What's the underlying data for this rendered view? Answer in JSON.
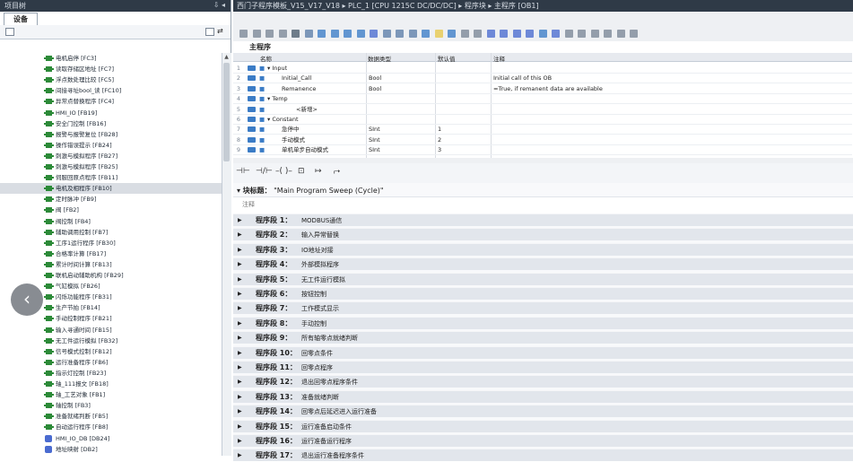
{
  "project_panel": {
    "title": "项目树",
    "pin_controls": "⇩ ◂",
    "devices_tab": "设备",
    "tree": [
      {
        "label": "电机启停 [FC3]",
        "kind": "block"
      },
      {
        "label": "读取存储区地址 [FC7]",
        "kind": "block"
      },
      {
        "label": "浮点数处理比较 [FC5]",
        "kind": "block"
      },
      {
        "label": "间接寻址bool_读 [FC10]",
        "kind": "block"
      },
      {
        "label": "异常点替换程序 [FC4]",
        "kind": "block"
      },
      {
        "label": "HMI_IO [FB19]",
        "kind": "block"
      },
      {
        "label": "安全门控制 [FB16]",
        "kind": "block"
      },
      {
        "label": "报警与报警复位 [FB28]",
        "kind": "block"
      },
      {
        "label": "操作错误提示 [FB24]",
        "kind": "block"
      },
      {
        "label": "刺激与模拟程序 [FB27]",
        "kind": "block"
      },
      {
        "label": "刺激与模拟程序 [FB25]",
        "kind": "block"
      },
      {
        "label": "伺服回原点程序 [FB11]",
        "kind": "block"
      },
      {
        "label": "电机及相程序 [FB10]",
        "kind": "block",
        "selected": true
      },
      {
        "label": "定时脉冲 [FB9]",
        "kind": "block"
      },
      {
        "label": "阀 [FB2]",
        "kind": "block"
      },
      {
        "label": "阀控制 [FB4]",
        "kind": "block"
      },
      {
        "label": "辅助调用控制 [FB7]",
        "kind": "block"
      },
      {
        "label": "工序1运行程序 [FB30]",
        "kind": "block"
      },
      {
        "label": "合格率计算 [FB17]",
        "kind": "block"
      },
      {
        "label": "累计时间计算 [FB13]",
        "kind": "block"
      },
      {
        "label": "联机启动辅助机构 [FB29]",
        "kind": "block"
      },
      {
        "label": "气缸模拟 [FB26]",
        "kind": "block"
      },
      {
        "label": "闪烁功能程序 [FB31]",
        "kind": "block"
      },
      {
        "label": "生产节拍 [FB14]",
        "kind": "block"
      },
      {
        "label": "手动控制程序 [FB21]",
        "kind": "block"
      },
      {
        "label": "输入寻通时间 [FB15]",
        "kind": "block"
      },
      {
        "label": "无工件运行模拟 [FB32]",
        "kind": "block"
      },
      {
        "label": "信号模式控制 [FB12]",
        "kind": "block"
      },
      {
        "label": "运行准备程序 [FB6]",
        "kind": "block"
      },
      {
        "label": "指示灯控制 [FB23]",
        "kind": "block"
      },
      {
        "label": "轴_111报文 [FB18]",
        "kind": "block"
      },
      {
        "label": "轴_工艺对象 [FB1]",
        "kind": "block"
      },
      {
        "label": "轴控制 [FB3]",
        "kind": "block"
      },
      {
        "label": "准备就绪判断 [FB5]",
        "kind": "block"
      },
      {
        "label": "自动运行程序 [FB8]",
        "kind": "block"
      },
      {
        "label": "HMI_IO_DB [DB24]",
        "kind": "db"
      },
      {
        "label": "地址映射 [DB2]",
        "kind": "db"
      }
    ]
  },
  "editor": {
    "breadcrumb": "西门子程序模板_V15_V17_V18 ▸ PLC_1 [CPU 1215C DC/DC/DC] ▸ 程序块 ▸ 主程序 [OB1]",
    "interface_title": "主程序",
    "columns": [
      "名称",
      "数据类型",
      "默认值",
      "注释"
    ],
    "rows": [
      {
        "num": "1",
        "name": "▾ Input",
        "type": "",
        "default": "",
        "comment": "",
        "indent": 0
      },
      {
        "num": "2",
        "name": "Initial_Call",
        "type": "Bool",
        "default": "",
        "comment": "Initial call of this OB",
        "indent": 1
      },
      {
        "num": "3",
        "name": "Remanence",
        "type": "Bool",
        "default": "",
        "comment": "=True, if remanent data are available",
        "indent": 1
      },
      {
        "num": "4",
        "name": "▾ Temp",
        "type": "",
        "default": "",
        "comment": "",
        "indent": 0
      },
      {
        "num": "5",
        "name": "<新增>",
        "type": "",
        "default": "",
        "comment": "",
        "indent": 2
      },
      {
        "num": "6",
        "name": "▾ Constant",
        "type": "",
        "default": "",
        "comment": "",
        "indent": 0
      },
      {
        "num": "7",
        "name": "急停中",
        "type": "SInt",
        "default": "1",
        "comment": "",
        "indent": 1
      },
      {
        "num": "8",
        "name": "手动模式",
        "type": "SInt",
        "default": "2",
        "comment": "",
        "indent": 1
      },
      {
        "num": "9",
        "name": "单机单步自动模式",
        "type": "SInt",
        "default": "3",
        "comment": "",
        "indent": 1
      }
    ],
    "ladder_icons": [
      "⊣⊢",
      "⊣/⊢",
      "–( )–",
      "⊡",
      "↦",
      "⮣"
    ],
    "block_title_label": "块标题：",
    "block_title": "\"Main Program Sweep (Cycle)\"",
    "comment_label": "注释",
    "segments": [
      {
        "label": "程序段 1：",
        "title": "MODBUS通信",
        "name": ""
      },
      {
        "label": "程序段 2：",
        "title": "输入异常替换",
        "name": ""
      },
      {
        "label": "程序段 3：",
        "title": "IO地址对接",
        "name": ""
      },
      {
        "label": "程序段 4：",
        "title": "外部模拟程序",
        "name": ""
      },
      {
        "label": "程序段 5：",
        "title": "无工件运行模拟",
        "name": ""
      },
      {
        "label": "程序段 6：",
        "title": "按钮控制",
        "name": ""
      },
      {
        "label": "程序段 7：",
        "title": "工作模式显示",
        "name": ""
      },
      {
        "label": "程序段 8：",
        "title": "手动控制",
        "name": ""
      },
      {
        "label": "程序段 9：",
        "title": "所有轴零点就绪判断",
        "name": ""
      },
      {
        "label": "程序段 10：",
        "title": "回零点条件",
        "name": ""
      },
      {
        "label": "程序段 11：",
        "title": "回零点程序",
        "name": ""
      },
      {
        "label": "程序段 12：",
        "title": "退出回零点程序条件",
        "name": ""
      },
      {
        "label": "程序段 13：",
        "title": "准备就绪判断",
        "name": ""
      },
      {
        "label": "程序段 14：",
        "title": "回零点后延迟进入运行准备",
        "name": ""
      },
      {
        "label": "程序段 15：",
        "title": "运行准备启动条件",
        "name": ""
      },
      {
        "label": "程序段 16：",
        "title": "运行准备运行程序",
        "name": ""
      },
      {
        "label": "程序段 17：",
        "title": "退出运行准备程序条件",
        "name": ""
      }
    ]
  }
}
